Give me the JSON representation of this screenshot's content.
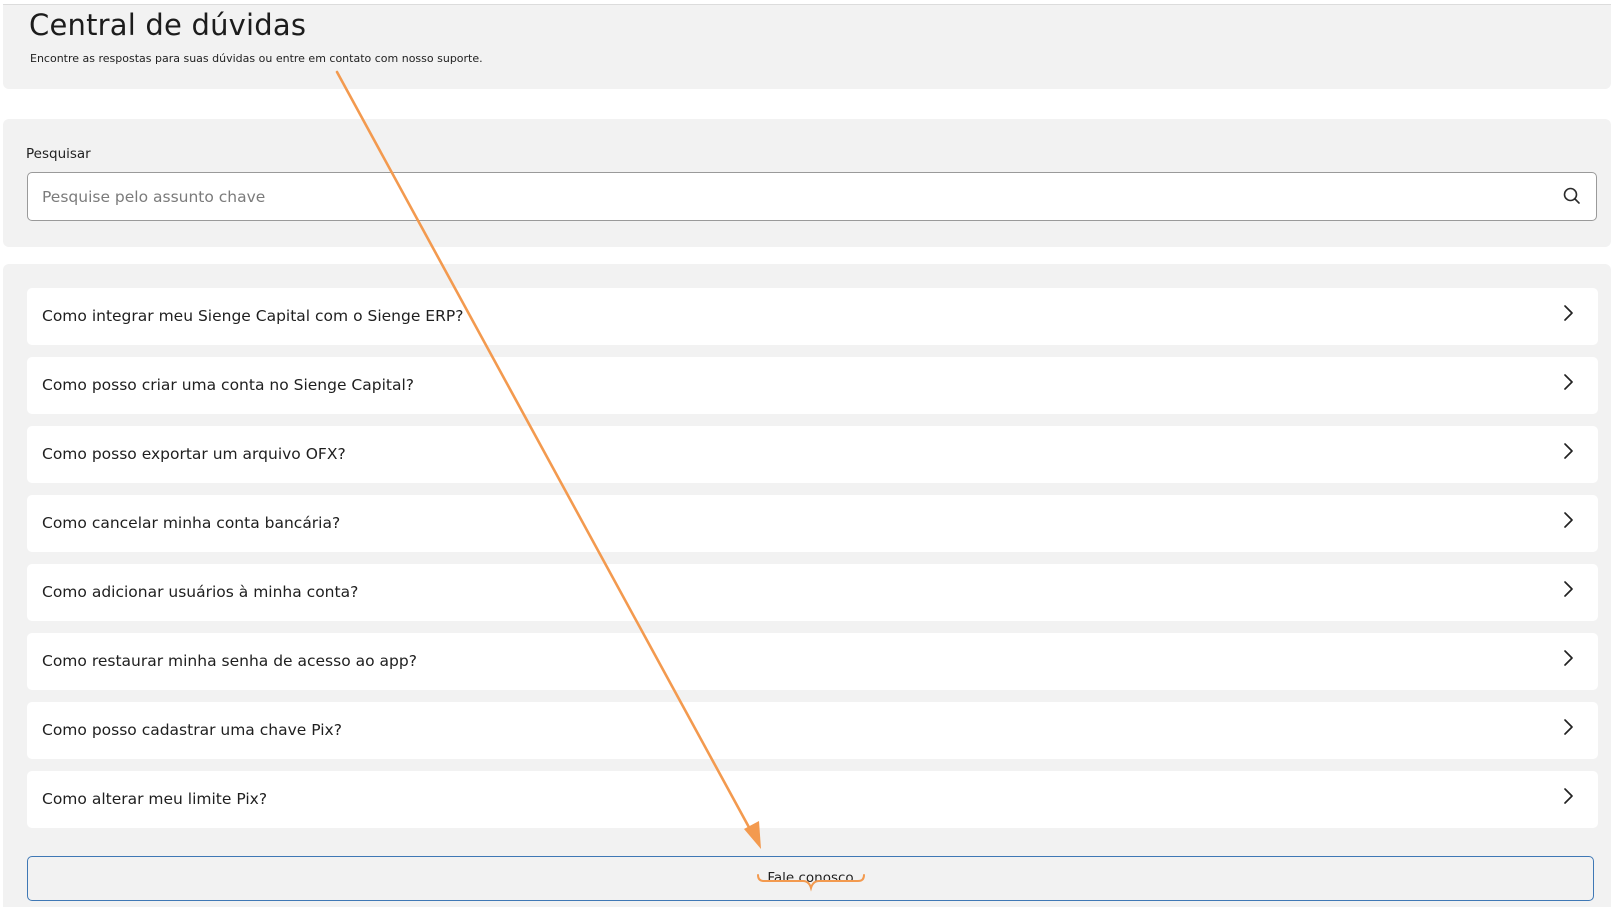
{
  "header": {
    "title": "Central de dúvidas",
    "subtitle": "Encontre as respostas para suas dúvidas ou entre em contato com nosso suporte."
  },
  "search": {
    "label": "Pesquisar",
    "placeholder": "Pesquise pelo assunto chave",
    "value": "",
    "icon": "search-icon"
  },
  "faq": {
    "items": [
      {
        "label": "Como integrar meu Sienge Capital com o Sienge ERP?",
        "icon": "chevron-right-icon"
      },
      {
        "label": "Como posso criar uma conta no Sienge Capital?",
        "icon": "chevron-right-icon"
      },
      {
        "label": "Como posso exportar um arquivo OFX?",
        "icon": "chevron-right-icon"
      },
      {
        "label": "Como cancelar minha conta bancária?",
        "icon": "chevron-right-icon"
      },
      {
        "label": "Como adicionar usuários à minha conta?",
        "icon": "chevron-right-icon"
      },
      {
        "label": "Como restaurar minha senha de acesso ao app?",
        "icon": "chevron-right-icon"
      },
      {
        "label": "Como posso cadastrar uma chave Pix?",
        "icon": "chevron-right-icon"
      },
      {
        "label": "Como alterar meu limite Pix?",
        "icon": "chevron-right-icon"
      }
    ]
  },
  "contact": {
    "label": "Fale conosco"
  },
  "colors": {
    "card_background": "#f2f2f2",
    "contact_border": "#3f78b5",
    "annotation": "#f39a4f"
  }
}
